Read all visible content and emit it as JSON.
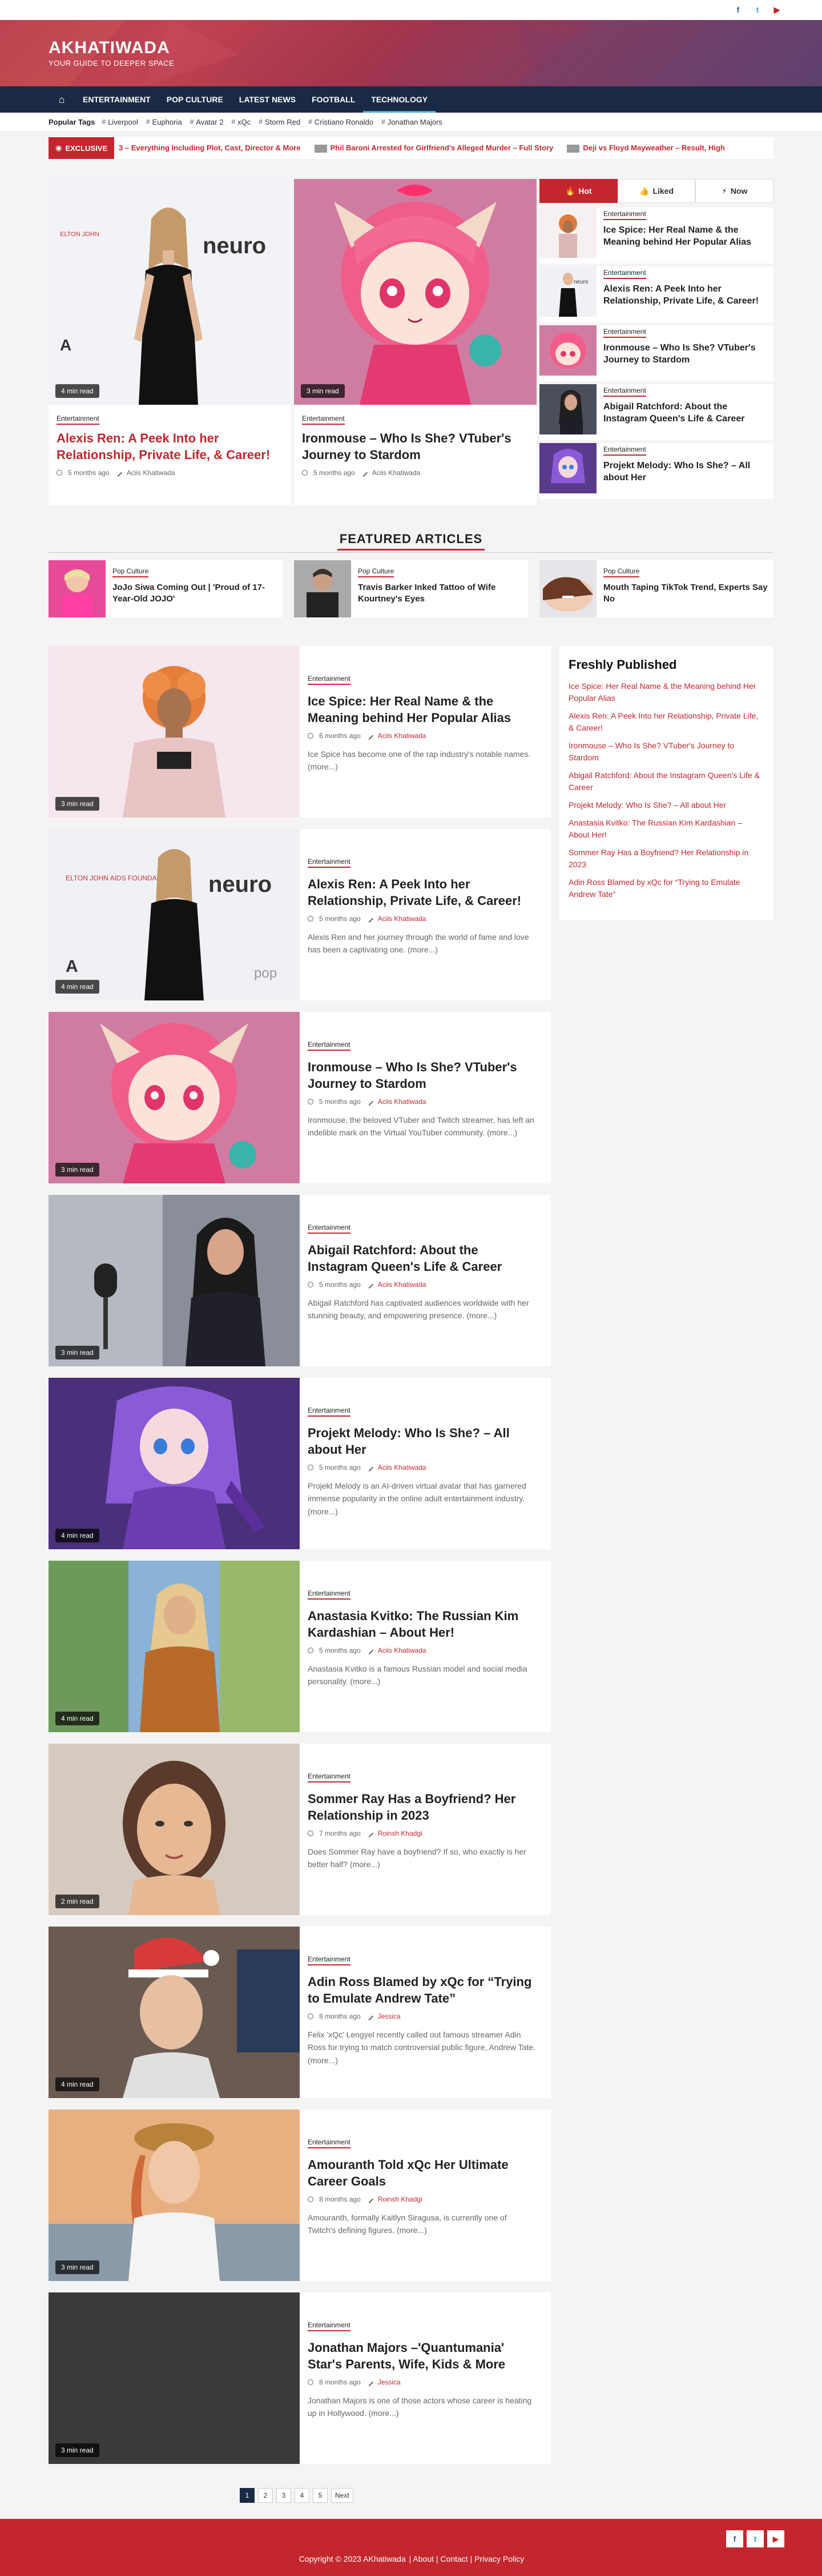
{
  "topbar": {
    "social": [
      "f",
      "t",
      "▶"
    ]
  },
  "header": {
    "site_name": "AKHATIWADA",
    "tagline": "YOUR GUIDE TO DEEPER SPACE"
  },
  "nav": {
    "items": [
      "ENTERTAINMENT",
      "POP CULTURE",
      "LATEST NEWS",
      "FOOTBALL",
      "TECHNOLOGY"
    ],
    "active": "TECHNOLOGY"
  },
  "popular_tags": {
    "label": "Popular Tags",
    "tags": [
      "Liverpool",
      "Euphoria",
      "Avatar 2",
      "xQc",
      "Storm Red",
      "Cristiano Ronaldo",
      "Jonathan Majors"
    ]
  },
  "ticker": {
    "label": "EXCLUSIVE",
    "items": [
      "3 – Everything Including Plot, Cast, Director & More",
      "Phil Baroni Arrested for Girlfriend's Alleged Murder – Full Story",
      "Deji vs Floyd Mayweather – Result, High"
    ]
  },
  "hero": [
    {
      "category": "Entertainment",
      "title": "Alexis Ren: A Peek Into her Relationship, Private Life, & Career!",
      "time": "5 months ago",
      "author": "Aciis Khatiwada",
      "read": "4 min read",
      "img_text": "ELTON JOHN AIDS FOUNDATION  neuro"
    },
    {
      "category": "Entertainment",
      "title": "Ironmouse – Who Is She? VTuber's Journey to Stardom",
      "time": "5 months ago",
      "author": "Aciis Khatiwada",
      "read": "3 min read"
    }
  ],
  "tabs": [
    "Hot",
    "Liked",
    "Now"
  ],
  "side": [
    {
      "category": "Entertainment",
      "title": "Ice Spice: Her Real Name & the Meaning behind Her Popular Alias"
    },
    {
      "category": "Entertainment",
      "title": "Alexis Ren: A Peek Into her Relationship, Private Life, & Career!"
    },
    {
      "category": "Entertainment",
      "title": "Ironmouse – Who Is She? VTuber's Journey to Stardom"
    },
    {
      "category": "Entertainment",
      "title": "Abigail Ratchford: About the Instagram Queen's Life & Career"
    },
    {
      "category": "Entertainment",
      "title": "Projekt Melody: Who Is She? – All about Her"
    }
  ],
  "featured": {
    "heading": "FEATURED ARTICLES",
    "items": [
      {
        "category": "Pop Culture",
        "title": "JoJo Siwa Coming Out | 'Proud of 17-Year-Old JOJO'"
      },
      {
        "category": "Pop Culture",
        "title": "Travis Barker Inked Tattoo of Wife Kourtney's Eyes"
      },
      {
        "category": "Pop Culture",
        "title": "Mouth Taping TikTok Trend, Experts Say No"
      }
    ]
  },
  "list": [
    {
      "category": "Entertainment",
      "title": "Ice Spice: Her Real Name & the Meaning behind Her Popular Alias",
      "time": "6 months ago",
      "author": "Aciis Khatiwada",
      "excerpt": "Ice Spice has become one of the rap industry's notable names. (more...)",
      "read": "3 min read"
    },
    {
      "category": "Entertainment",
      "title": "Alexis Ren: A Peek Into her Relationship, Private Life, & Career!",
      "time": "5 months ago",
      "author": "Aciis Khatiwada",
      "excerpt": "Alexis Ren and her journey through the world of fame and love has been a captivating one. (more...)",
      "read": "4 min read"
    },
    {
      "category": "Entertainment",
      "title": "Ironmouse – Who Is She? VTuber's Journey to Stardom",
      "time": "5 months ago",
      "author": "Aciis Khatiwada",
      "excerpt": "Ironmouse, the beloved VTuber and Twitch streamer, has left an indelible mark on the Virtual YouTuber community. (more...)",
      "read": "3 min read"
    },
    {
      "category": "Entertainment",
      "title": "Abigail Ratchford: About the Instagram Queen's Life & Career",
      "time": "5 months ago",
      "author": "Aciis Khatiwada",
      "excerpt": "Abigail Ratchford has captivated audiences worldwide with her stunning beauty, and empowering presence. (more...)",
      "read": "3 min read"
    },
    {
      "category": "Entertainment",
      "title": "Projekt Melody: Who Is She? – All about Her",
      "time": "5 months ago",
      "author": "Aciis Khatiwada",
      "excerpt": "Projekt Melody is an AI-driven virtual avatar that has garnered immense popularity in the online adult entertainment industry. (more...)",
      "read": "4 min read"
    },
    {
      "category": "Entertainment",
      "title": "Anastasia Kvitko: The Russian Kim Kardashian – About Her!",
      "time": "5 months ago",
      "author": "Aciis Khatiwada",
      "excerpt": "Anastasia Kvitko is a famous Russian model and social media personality. (more...)",
      "read": "4 min read"
    },
    {
      "category": "Entertainment",
      "title": "Sommer Ray Has a Boyfriend? Her Relationship in 2023",
      "time": "7 months ago",
      "author": "Roinsh Khadgi",
      "excerpt": "Does Sommer Ray have a boyfriend? If so, who exactly is her better half? (more...)",
      "read": "2 min read"
    },
    {
      "category": "Entertainment",
      "title": "Adin Ross Blamed by xQc for “Trying to Emulate Andrew Tate”",
      "time": "8 months ago",
      "author": "Jessica",
      "excerpt": "Felix 'xQc' Lengyel recently called out famous streamer Adin Ross for trying to match controversial public figure, Andrew Tate. (more...)",
      "read": "4 min read"
    },
    {
      "category": "Entertainment",
      "title": "Amouranth Told xQc Her Ultimate Career Goals",
      "time": "8 months ago",
      "author": "Roinsh Khadgi",
      "excerpt": "Amouranth, formally Kaitlyn Siragusa, is currently one of Twitch's defining figures. (more...)",
      "read": "3 min read"
    },
    {
      "category": "Entertainment",
      "title": "Jonathan Majors –'Quantumania' Star's Parents, Wife, Kids & More",
      "time": "8 months ago",
      "author": "Jessica",
      "excerpt": "Jonathan Majors is one of those actors whose career is heating up in Hollywood. (more...)",
      "read": "3 min read"
    }
  ],
  "fresh": {
    "heading": "Freshly Published",
    "links": [
      "Ice Spice: Her Real Name & the Meaning behind Her Popular Alias",
      "Alexis Ren: A Peek Into her Relationship, Private Life, & Career!",
      "Ironmouse – Who Is She? VTuber's Journey to Stardom",
      "Abigail Ratchford: About the Instagram Queen's Life & Career",
      "Projekt Melody: Who Is She? – All about Her",
      "Anastasia Kvitko: The Russian Kim Kardashian – About Her!",
      "Sommer Ray Has a Boyfriend? Her Relationship in 2023",
      "Adin Ross Blamed by xQc for “Trying to Emulate Andrew Tate”"
    ]
  },
  "pager": {
    "pages": [
      "1",
      "2",
      "3",
      "4",
      "5"
    ],
    "next": "Next",
    "current": "1"
  },
  "footer": {
    "copyright": "Copyright © 2023 AKhatiwada",
    "links": [
      "About",
      "Contact",
      "Privacy Policy"
    ]
  },
  "colors": {
    "accent": "#c4262e",
    "nav": "#1b2a44"
  }
}
